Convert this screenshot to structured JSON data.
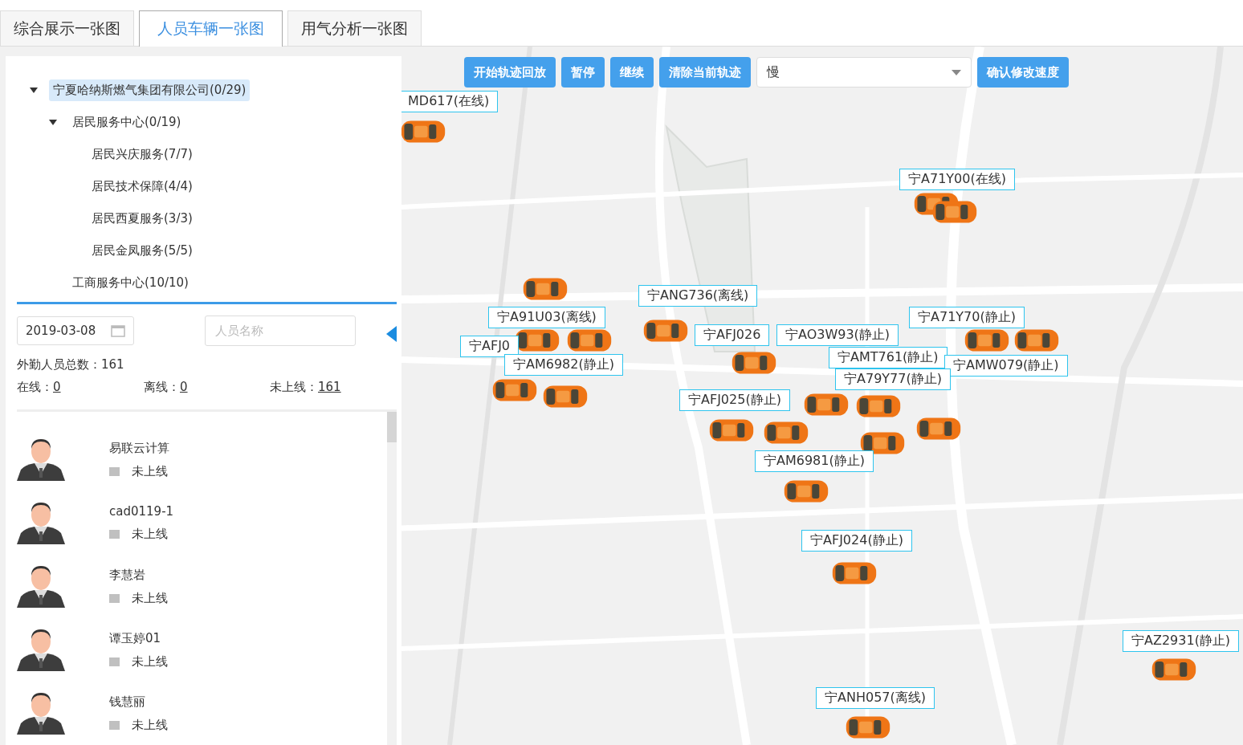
{
  "tabs": [
    {
      "label": "综合展示一张图",
      "selected": false
    },
    {
      "label": "人员车辆一张图",
      "selected": true
    },
    {
      "label": "用气分析一张图",
      "selected": false
    }
  ],
  "tree": [
    {
      "label": "宁夏哈纳斯燃气集团有限公司(0/29)",
      "expanded": true,
      "selected": true,
      "children": [
        {
          "label": "居民服务中心(0/19)",
          "expanded": true,
          "selected": false,
          "children": [
            {
              "label": "居民兴庆服务(7/7)",
              "selected": false
            },
            {
              "label": "居民技术保障(4/4)",
              "selected": false
            },
            {
              "label": "居民西夏服务(3/3)",
              "selected": false
            },
            {
              "label": "居民金凤服务(5/5)",
              "selected": false
            }
          ]
        },
        {
          "label": "工商服务中心(10/10)",
          "selected": false
        }
      ]
    }
  ],
  "filters": {
    "date": "2019-03-08",
    "name_placeholder": "人员名称"
  },
  "stats": {
    "total_label": "外勤人员总数：",
    "total": "161",
    "counts": [
      {
        "label": "在线：",
        "value": "0"
      },
      {
        "label": "离线：",
        "value": "0"
      },
      {
        "label": "未上线：",
        "value": "161"
      }
    ]
  },
  "staff": [
    {
      "name": "易联云计算",
      "status": "未上线"
    },
    {
      "name": "cad0119-1",
      "status": "未上线"
    },
    {
      "name": "李慧岩",
      "status": "未上线"
    },
    {
      "name": "谭玉婷01",
      "status": "未上线"
    },
    {
      "name": "钱慧丽",
      "status": "未上线"
    }
  ],
  "map": {
    "buttons": [
      "开始轨迹回放",
      "暂停",
      "继续",
      "清除当前轨迹"
    ],
    "speed": "慢",
    "confirm": "确认修改速度",
    "vehicles": [
      {
        "label": "MD617(在线)"
      },
      {
        "label": "宁A71Y00(在线)"
      },
      {
        "label": "宁ANG736(离线)"
      },
      {
        "label": "宁A91U03(离线)"
      },
      {
        "label": "宁AFJ0"
      },
      {
        "label": "宁AM6982(静止)"
      },
      {
        "label": "宁AFJ026"
      },
      {
        "label": "宁AO3W93(静止)"
      },
      {
        "label": "宁A71Y70(静止)"
      },
      {
        "label": "宁AMT761(静止)"
      },
      {
        "label": "宁AMW079(静止)"
      },
      {
        "label": "宁A79Y77(静止)"
      },
      {
        "label": "宁AFJ025(静止)"
      },
      {
        "label": "宁AM6981(静止)"
      },
      {
        "label": "宁AFJ024(静止)"
      },
      {
        "label": "宁AZ2931(静止)"
      },
      {
        "label": "宁ANH057(离线)"
      }
    ]
  }
}
